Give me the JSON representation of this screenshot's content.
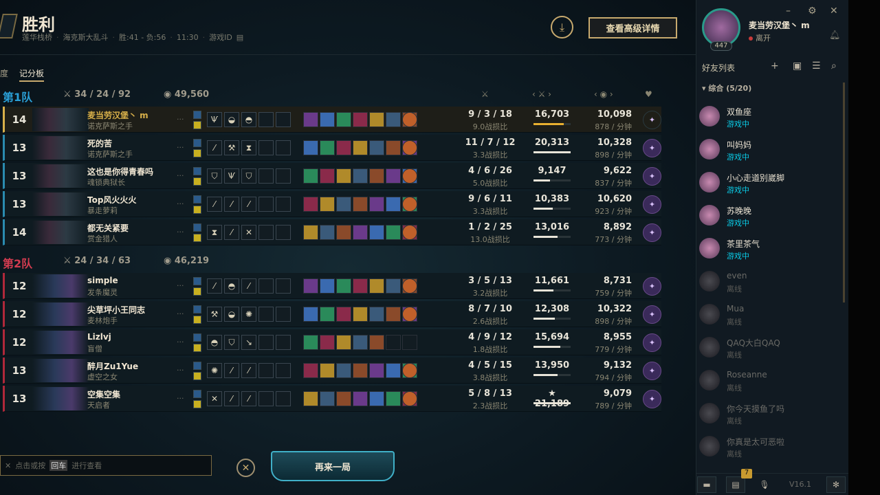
{
  "header": {
    "result": "胜利",
    "map": "莲华栈桥",
    "mode": "海克斯大乱斗",
    "record": "胜:41 - 负:56",
    "time": "11:30",
    "game_id_label": "游戏ID",
    "detail_button": "查看高级详情"
  },
  "tabs": [
    "度",
    "记分板"
  ],
  "team1": {
    "name": "第1队",
    "kda": "34 / 24 / 92",
    "gold": "49,560",
    "color": "#2a9fd6"
  },
  "team2": {
    "name": "第2队",
    "kda": "24 / 34 / 63",
    "gold": "46,219",
    "color": "#d23c50"
  },
  "players_t1": [
    {
      "level": "14",
      "name": "麦当劳汉堡丶 m",
      "champ": "诺克萨斯之手",
      "kda": "9 / 3 / 18",
      "ratio": "9.0战损比",
      "dmg": "16,703",
      "dmg_frac": 0.82,
      "gold": "10,098",
      "gpm": "878 / 分钟",
      "runes": [
        "Ѱ",
        "◒",
        "◓"
      ]
    },
    {
      "level": "13",
      "name": "死的苦",
      "champ": "诺克萨斯之手",
      "kda": "11 / 7 / 12",
      "ratio": "3.3战损比",
      "dmg": "20,313",
      "dmg_frac": 1.0,
      "gold": "10,328",
      "gpm": "898 / 分钟",
      "runes": [
        "⁄",
        "⚒",
        "⧗"
      ]
    },
    {
      "level": "13",
      "name": "这也是你得青春吗",
      "champ": "魂锁典狱长",
      "kda": "4 / 6 / 26",
      "ratio": "5.0战损比",
      "dmg": "9,147",
      "dmg_frac": 0.45,
      "gold": "9,622",
      "gpm": "837 / 分钟",
      "runes": [
        "⛉",
        "Ѱ",
        "⛉"
      ]
    },
    {
      "level": "13",
      "name": "Top风火火火",
      "champ": "暴走萝莉",
      "kda": "9 / 6 / 11",
      "ratio": "3.3战损比",
      "dmg": "10,383",
      "dmg_frac": 0.51,
      "gold": "10,620",
      "gpm": "923 / 分钟",
      "runes": [
        "⁄",
        "⁄",
        "⁄"
      ]
    },
    {
      "level": "14",
      "name": "都无关紧要",
      "champ": "赏金猎人",
      "kda": "1 / 2 / 25",
      "ratio": "13.0战损比",
      "dmg": "13,016",
      "dmg_frac": 0.64,
      "gold": "8,892",
      "gpm": "773 / 分钟",
      "runes": [
        "⧗",
        "⁄",
        "✕"
      ]
    }
  ],
  "players_t2": [
    {
      "level": "12",
      "name": "simple",
      "champ": "发条魔灵",
      "kda": "3 / 5 / 13",
      "ratio": "3.2战损比",
      "dmg": "11,661",
      "dmg_frac": 0.54,
      "gold": "8,731",
      "gpm": "759 / 分钟",
      "runes": [
        "⁄",
        "◓",
        "⁄"
      ]
    },
    {
      "level": "12",
      "name": "尖草坪小王同志",
      "champ": "麦林炮手",
      "kda": "8 / 7 / 10",
      "ratio": "2.6战损比",
      "dmg": "12,308",
      "dmg_frac": 0.57,
      "gold": "10,322",
      "gpm": "898 / 分钟",
      "runes": [
        "⚒",
        "◒",
        "✺"
      ]
    },
    {
      "level": "12",
      "name": "Lizlvj",
      "champ": "盲僧",
      "kda": "4 / 9 / 12",
      "ratio": "1.8战损比",
      "dmg": "15,694",
      "dmg_frac": 0.73,
      "gold": "8,955",
      "gpm": "779 / 分钟",
      "runes": [
        "◓",
        "⛉",
        "↘"
      ]
    },
    {
      "level": "13",
      "name": "醉月Zu1Yue",
      "champ": "虚空之女",
      "kda": "4 / 5 / 15",
      "ratio": "3.8战损比",
      "dmg": "13,950",
      "dmg_frac": 0.65,
      "gold": "9,132",
      "gpm": "794 / 分钟",
      "runes": [
        "✺",
        "⁄",
        "⁄"
      ]
    },
    {
      "level": "13",
      "name": "空集空集",
      "champ": "天启者",
      "kda": "5 / 8 / 13",
      "ratio": "2.3战损比",
      "dmg": "★ 21,189",
      "dmg_frac": 1.0,
      "gold": "9,079",
      "gpm": "789 / 分钟",
      "runes": [
        "✕",
        "⁄",
        "⁄"
      ]
    }
  ],
  "search": {
    "text_a": "点击或按",
    "key": "回车",
    "text_b": "进行查看"
  },
  "again_button": "再来一局",
  "sidebar": {
    "user": "麦当劳汉堡丶 m",
    "level": "447",
    "status": "离开",
    "friends_title": "好友列表",
    "group": "综合 (5/20)",
    "version": "V16.1",
    "notif": "7",
    "friends": [
      {
        "name": "双鱼座",
        "status": "游戏中",
        "online": true
      },
      {
        "name": "叫妈妈",
        "status": "游戏中",
        "online": true
      },
      {
        "name": "小心走道别崴脚",
        "status": "游戏中",
        "online": true
      },
      {
        "name": "苏晚晚",
        "status": "游戏中",
        "online": true
      },
      {
        "name": "茶里茶气",
        "status": "游戏中",
        "online": true
      },
      {
        "name": "even",
        "status": "离线",
        "online": false
      },
      {
        "name": "Mua",
        "status": "离线",
        "online": false
      },
      {
        "name": "QAQ大白QAQ",
        "status": "离线",
        "online": false
      },
      {
        "name": "Roseanne",
        "status": "离线",
        "online": false
      },
      {
        "name": "你今天摸鱼了吗",
        "status": "离线",
        "online": false
      },
      {
        "name": "你真是太可恶啦",
        "status": "离线",
        "online": false
      }
    ]
  }
}
